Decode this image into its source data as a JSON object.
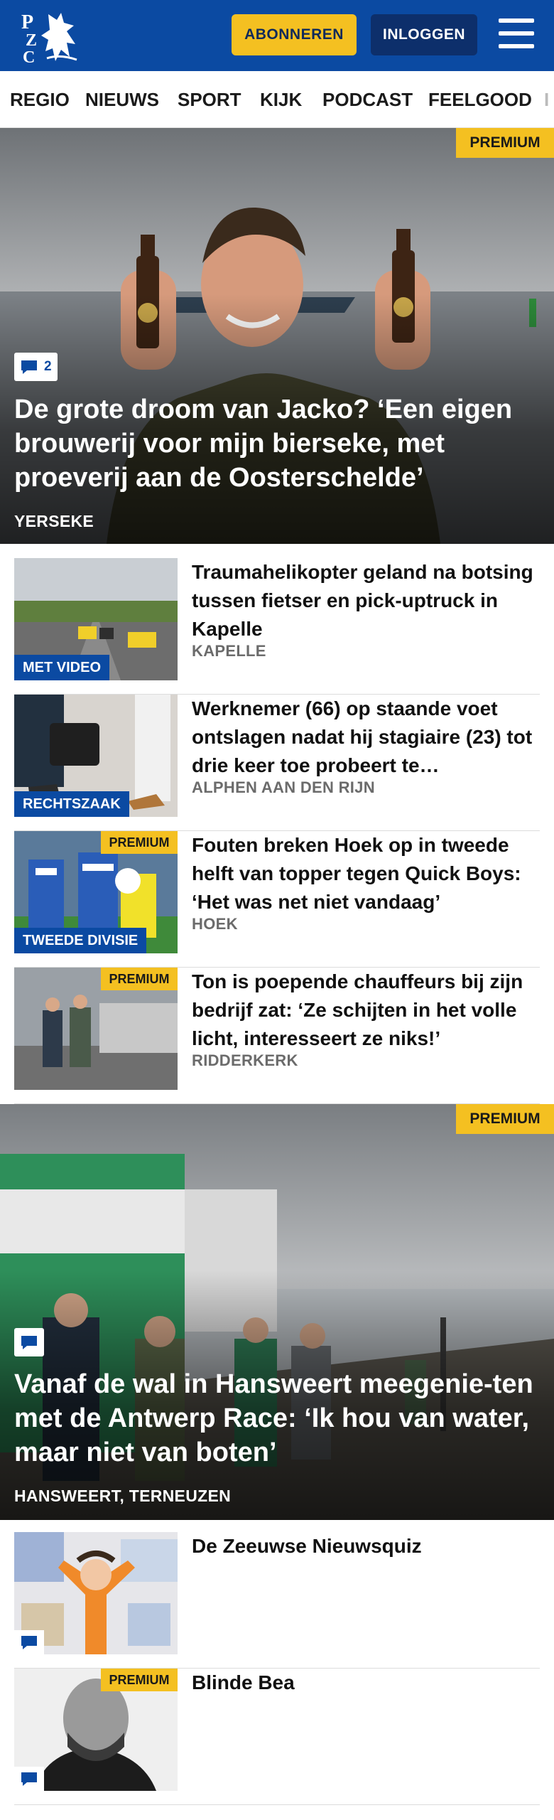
{
  "header": {
    "logo_text": "PZC",
    "subscribe_label": "ABONNEREN",
    "login_label": "INLOGGEN",
    "menu_icon": "hamburger-menu-icon",
    "brand_color": "#0b4aa2",
    "accent_color": "#f4c021"
  },
  "nav": {
    "items": [
      "REGIO",
      "NIEUWS",
      "SPORT",
      "KIJK",
      "PODCAST",
      "FEELGOOD",
      "I"
    ]
  },
  "hero1": {
    "premium": "PREMIUM",
    "comments": "2",
    "title": "De grote droom van Jacko? ‘Een eigen brouwerij voor mijn bierseke, met proeverij aan de Oosterschelde’",
    "location": "YERSEKE"
  },
  "items": [
    {
      "tag": "MET VIDEO",
      "title": "Traumahelikopter geland na botsing tussen fietser en pick-uptruck in Kapelle",
      "location": "KAPELLE"
    },
    {
      "tag": "RECHTSZAAK",
      "title": "Werknemer (66) op staande voet ontslagen nadat hij stagiaire (23) tot drie keer toe probeert te…",
      "location": "ALPHEN AAN DEN RIJN"
    },
    {
      "tag": "TWEEDE DIVISIE",
      "premium": "PREMIUM",
      "title": "Fouten breken Hoek op in tweede helft van topper tegen Quick Boys: ‘Het was net niet vandaag’",
      "location": "HOEK"
    },
    {
      "premium": "PREMIUM",
      "title": "Ton is poepende chauffeurs bij zijn bedrijf zat: ‘Ze schijten in het volle licht, interesseert ze niks!’",
      "location": "RIDDERKERK"
    }
  ],
  "hero2": {
    "premium": "PREMIUM",
    "title": "Vanaf de wal in Hansweert meegenie-ten met de Antwerp Race: ‘Ik hou van water, maar niet van boten’",
    "location": "HANSWEERT, TERNEUZEN"
  },
  "bottom_items": [
    {
      "title": "De Zeeuwse Nieuwsquiz"
    },
    {
      "premium": "PREMIUM",
      "title": "Blinde Bea"
    }
  ]
}
